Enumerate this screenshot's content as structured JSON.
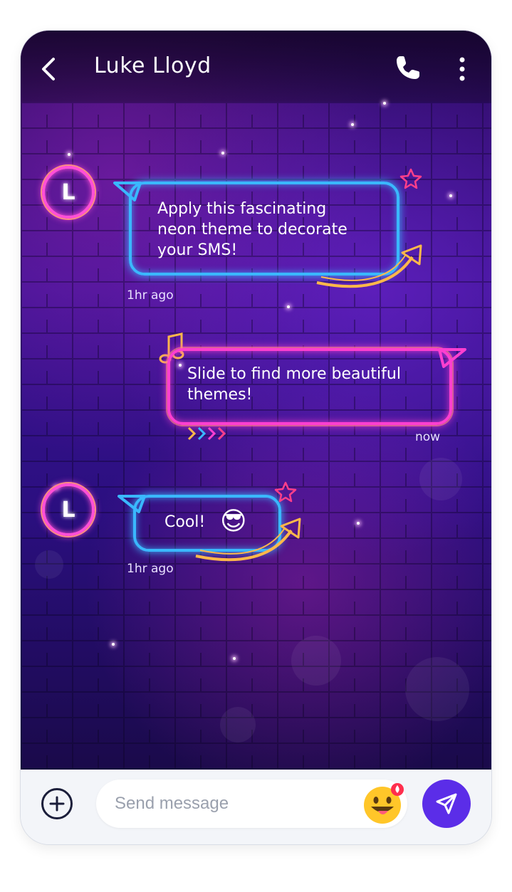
{
  "header": {
    "title": "Luke Lloyd"
  },
  "messages": [
    {
      "avatar_letter": "L",
      "text": "Apply this fascinating neon theme to decorate your SMS!",
      "lines": [
        "Apply this fascinating",
        "neon theme to decorate",
        "your SMS!"
      ],
      "time": "1hr ago",
      "direction": "incoming"
    },
    {
      "text": "Slide to find more beautiful themes!",
      "lines": [
        "Slide to find more beautiful",
        "themes!"
      ],
      "time": "now",
      "direction": "outgoing"
    },
    {
      "avatar_letter": "L",
      "text": "Cool!",
      "emoji": "😎",
      "time": "1hr ago",
      "direction": "incoming"
    }
  ],
  "composer": {
    "placeholder": "Send message",
    "emoji": "😛"
  },
  "colors": {
    "accent": "#5b2de8",
    "neon_blue": "#3ab8ff",
    "neon_pink": "#ff3fd0",
    "neon_orange": "#ffb84a"
  }
}
